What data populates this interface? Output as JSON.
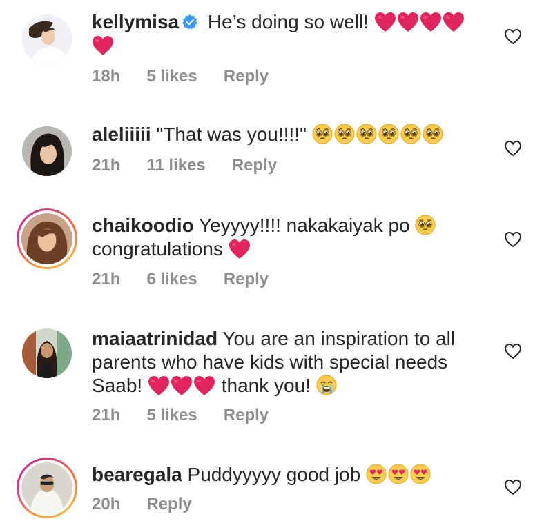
{
  "comments": [
    {
      "username": "kellymisa",
      "verified": true,
      "text": "He’s doing so well!",
      "time": "18h",
      "likes": "5 likes",
      "reply": "Reply"
    },
    {
      "username": "aleliiiii",
      "text": "\"That was you!!!!\"",
      "time": "21h",
      "likes": "11 likes",
      "reply": "Reply"
    },
    {
      "username": "chaikoodio",
      "text": "Yeyyyy!!!! nakakaiyak po",
      "text2": "congratulations",
      "time": "21h",
      "likes": "6 likes",
      "reply": "Reply"
    },
    {
      "username": "maiaatrinidad",
      "text": "You are an inspiration to all",
      "text2": "parents who have kids with special needs",
      "text3a": "Saab!",
      "text3b": "thank you!",
      "time": "21h",
      "likes": "5 likes",
      "reply": "Reply"
    },
    {
      "username": "bearegala",
      "text": "Puddyyyyy good job",
      "time": "20h",
      "reply": "Reply"
    }
  ],
  "colors": {
    "text": "#262626",
    "meta": "#8e8e8e",
    "verified": "#3897f0",
    "heart_emoji": "#e0245e"
  },
  "icons": [
    "verified-badge-icon",
    "red-heart-emoji",
    "pleading-face-emoji",
    "loudly-crying-face-emoji",
    "heart-eyes-emoji",
    "like-heart-icon"
  ]
}
